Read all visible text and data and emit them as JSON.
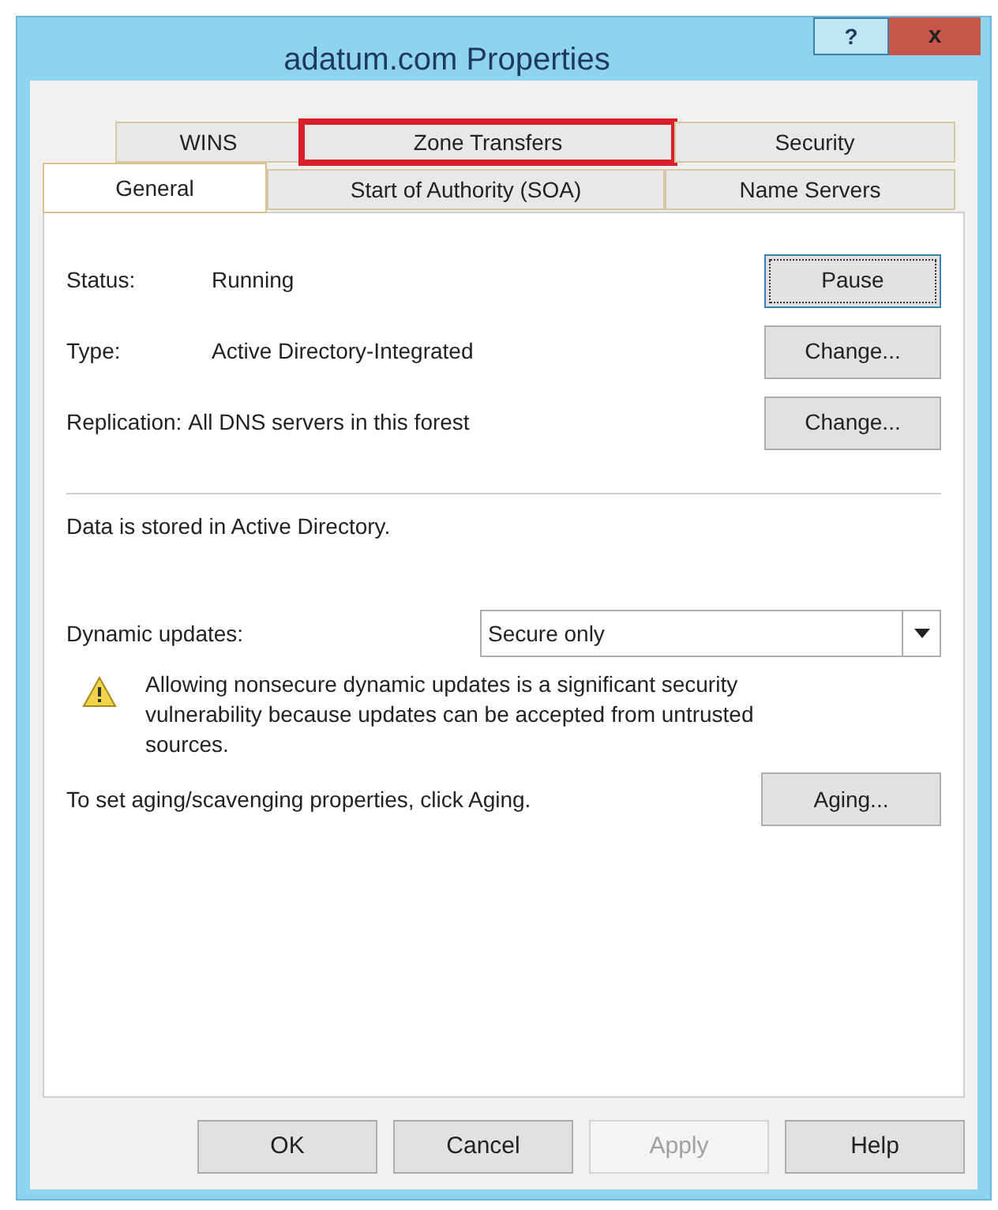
{
  "window": {
    "title": "adatum.com Properties",
    "help_button": "?",
    "close_button": "x"
  },
  "tab_rows": [
    [
      {
        "label": "WINS",
        "selected": false,
        "highlighted": false
      },
      {
        "label": "Zone Transfers",
        "selected": false,
        "highlighted": true
      },
      {
        "label": "Security",
        "selected": false,
        "highlighted": false
      }
    ],
    [
      {
        "label": "General",
        "selected": true,
        "highlighted": false
      },
      {
        "label": "Start of Authority (SOA)",
        "selected": false,
        "highlighted": false
      },
      {
        "label": "Name Servers",
        "selected": false,
        "highlighted": false
      }
    ]
  ],
  "properties": [
    {
      "label": "Status:",
      "value": "Running",
      "button": "Pause",
      "focused": true
    },
    {
      "label": "Type:",
      "value": "Active Directory-Integrated",
      "button": "Change...",
      "focused": false
    },
    {
      "label": "Replication:",
      "value": "All DNS servers in this forest",
      "button": "Change...",
      "focused": false
    }
  ],
  "storage_note": "Data is stored in Active Directory.",
  "dynamic_updates": {
    "label": "Dynamic updates:",
    "value": "Secure only"
  },
  "warning": "Allowing nonsecure dynamic updates is a significant security vulnerability because updates can be accepted from untrusted sources.",
  "aging": {
    "text": "To set aging/scavenging properties, click Aging.",
    "button": "Aging..."
  },
  "buttons": [
    {
      "label": "OK",
      "disabled": false
    },
    {
      "label": "Cancel",
      "disabled": false
    },
    {
      "label": "Apply",
      "disabled": true
    },
    {
      "label": "Help",
      "disabled": false
    }
  ]
}
